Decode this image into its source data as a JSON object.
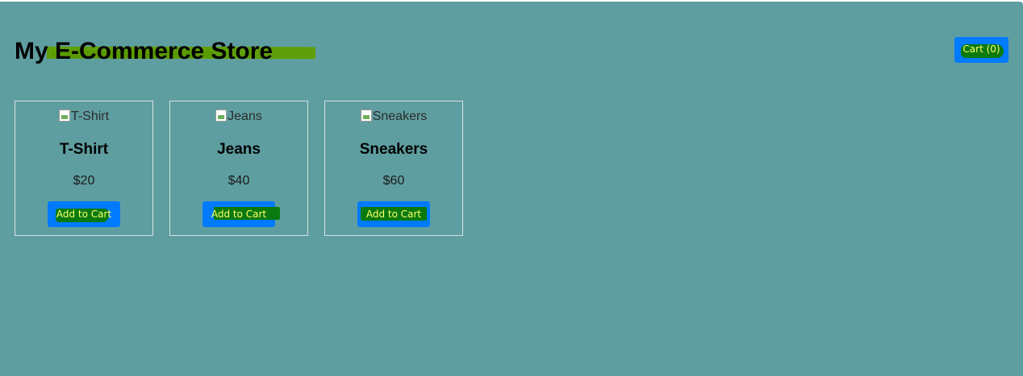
{
  "header": {
    "title": "My E-Commerce Store",
    "cart_label": "Cart (0)"
  },
  "products": [
    {
      "image_alt": "T-Shirt",
      "name": "T-Shirt",
      "price": "$20",
      "button_label": "Add to Cart"
    },
    {
      "image_alt": "Jeans",
      "name": "Jeans",
      "price": "$40",
      "button_label": "Add to Cart"
    },
    {
      "image_alt": "Sneakers",
      "name": "Sneakers",
      "price": "$60",
      "button_label": "Add to Cart"
    }
  ],
  "colors": {
    "background": "#5f9ea0",
    "button": "#007bff",
    "button_text": "#ffff66",
    "highlight": "#5f9f0a",
    "scribble": "#0a7a10"
  },
  "icons": {
    "product_image": "broken-image-icon"
  }
}
